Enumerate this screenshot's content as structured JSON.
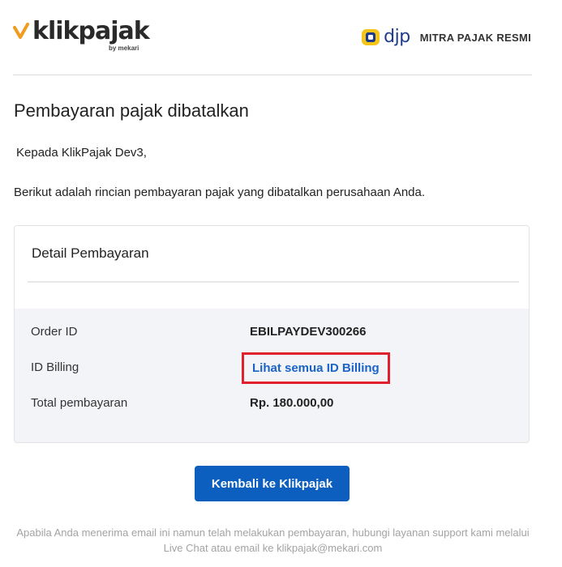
{
  "header": {
    "brand_name": "klikpajak",
    "brand_sub": "by mekari",
    "partner_logo_text": "djp",
    "partner_label": "MITRA PAJAK RESMI"
  },
  "content": {
    "title": "Pembayaran pajak dibatalkan",
    "greeting": "Kepada KlikPajak Dev3,",
    "intro": "Berikut adalah rincian pembayaran pajak yang dibatalkan perusahaan Anda."
  },
  "detail": {
    "heading": "Detail Pembayaran",
    "order_id_label": "Order ID",
    "order_id_value": "EBILPAYDEV300266",
    "billing_label": "ID Billing",
    "billing_link": "Lihat semua ID Billing",
    "total_label": "Total pembayaran",
    "total_value": "Rp. 180.000,00"
  },
  "cta": {
    "label": "Kembali ke Klikpajak"
  },
  "footer": {
    "text": "Apabila Anda menerima email ini namun telah melakukan pembayaran, hubungi layanan support kami melalui Live Chat atau email ke klikpajak@mekari.com"
  },
  "colors": {
    "accent_orange": "#f29c1f",
    "primary_blue": "#0c5fbf",
    "link_blue": "#1a63c7",
    "highlight_red": "#e0202c",
    "djp_yellow": "#f5c518",
    "djp_navy": "#1f3a8a"
  },
  "icons": {
    "brand_check": "checkmark-icon",
    "djp_logo": "djp-logo-icon"
  }
}
